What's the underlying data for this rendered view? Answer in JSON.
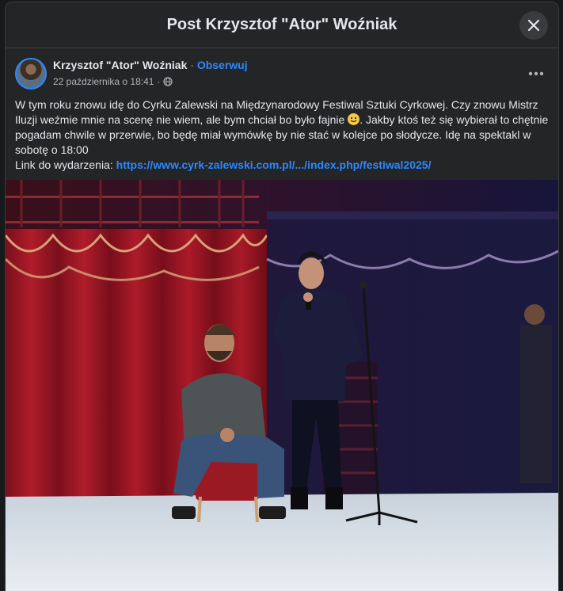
{
  "modal": {
    "title": "Post Krzysztof \"Ator\" Woźniak",
    "close_icon": "close-icon"
  },
  "post": {
    "author": "Krzysztof \"Ator\" Woźniak",
    "separator": "·",
    "follow": "Obserwuj",
    "date": "22 października o 18:41",
    "privacy_icon": "globe-icon",
    "more_icon": "more-icon",
    "text_part1": "W tym roku znowu idę do Cyrku Zalewski na Międzynarodowy Festiwal Sztuki Cyrkowej. Czy znowu Mistrz Iluzji weźmie mnie na scenę nie wiem, ale bym chciał bo było fajnie ",
    "text_part2": ". Jakby ktoś też się wybierał to chętnie pogadam chwile w przerwie, bo będę miał wymówkę by nie stać w kolejce po słodycze. Idę na spektakl w sobotę o 18:00",
    "emoji_icon": "smiling-face-icon",
    "link_label": "Link do wydarzenia:",
    "link_url": "https://www.cyrk-zalewski.com.pl/.../index.php/festiwal2025/"
  },
  "colors": {
    "accent": "#2d88ff",
    "background": "#242526",
    "text": "#e4e6eb",
    "muted": "#b0b3b8"
  }
}
